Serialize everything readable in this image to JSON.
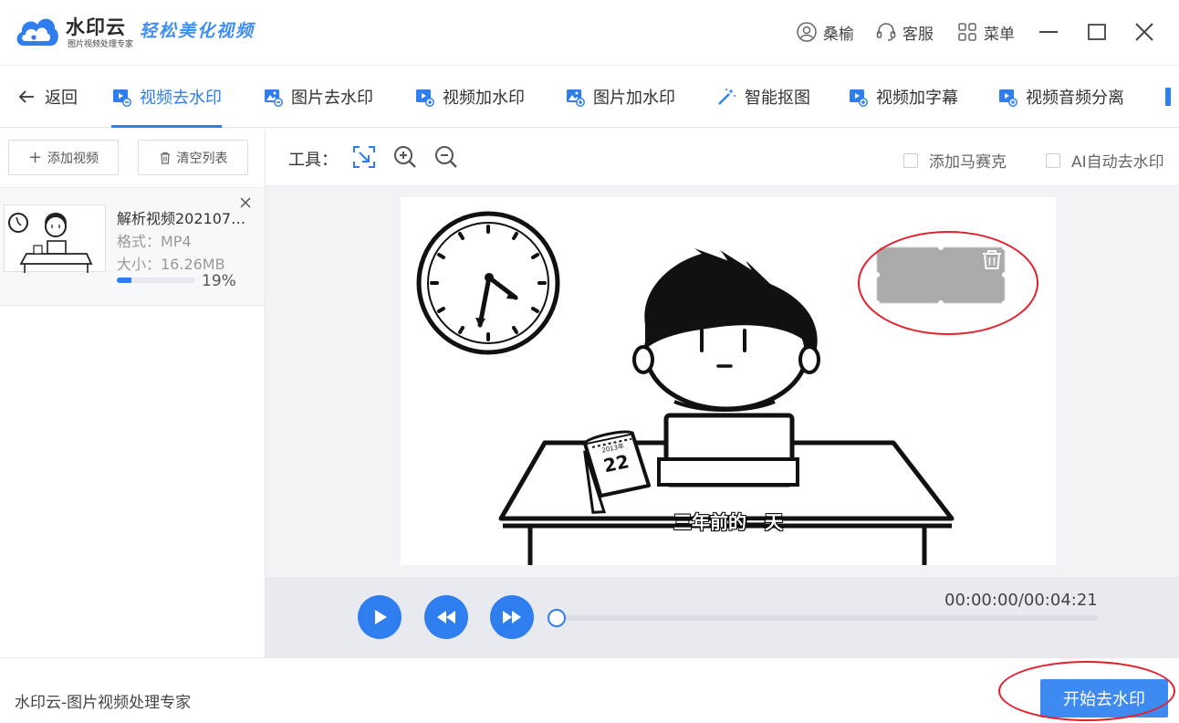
{
  "app": {
    "logo_text": "水印云",
    "logo_subtitle": "图片视频处理专家",
    "slogan": "轻松美化视频",
    "user_label": "桑榆",
    "service_label": "客服",
    "menu_label": "菜单"
  },
  "tabs": [
    {
      "label": "返回",
      "icon": "back-arrow-icon"
    },
    {
      "label": "视频去水印",
      "icon": "video-remove-icon",
      "active": true
    },
    {
      "label": "图片去水印",
      "icon": "image-remove-icon"
    },
    {
      "label": "视频加水印",
      "icon": "video-add-icon"
    },
    {
      "label": "图片加水印",
      "icon": "image-add-icon"
    },
    {
      "label": "智能抠图",
      "icon": "magic-wand-icon"
    },
    {
      "label": "视频加字幕",
      "icon": "video-subtitle-icon"
    },
    {
      "label": "视频音频分离",
      "icon": "video-audio-split-icon"
    }
  ],
  "sidebar": {
    "add_video_label": "添加视频",
    "clear_list_label": "清空列表",
    "file": {
      "name": "解析视频2021071...",
      "format": "格式：MP4",
      "size": "大小：16.26MB",
      "progress": 0.19,
      "progress_text": "19%"
    }
  },
  "tools": {
    "label": "工具：",
    "mosaic_label": "添加马赛克",
    "ai_label": "AI自动去水印"
  },
  "preview": {
    "subtitle": "三年前的一天",
    "calendar_text": "22",
    "calendar_top": "2013年"
  },
  "player": {
    "time_readout": "00:00:00/00:04:21",
    "progress": 0.0
  },
  "footer": {
    "brand_text": "水印云-图片视频处理专家",
    "start_label": "开始去水印"
  },
  "colors": {
    "accent": "#2f7ef0",
    "annotation_red": "#e3202c",
    "watermark_box": "#aaaaaa"
  }
}
